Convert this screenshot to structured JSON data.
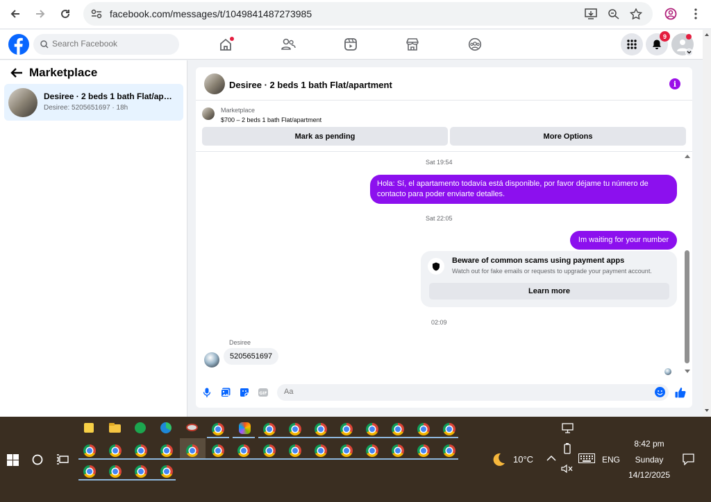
{
  "browser": {
    "url": "facebook.com/messages/t/1049841487273985"
  },
  "header": {
    "search_placeholder": "Search Facebook",
    "notification_count": "9"
  },
  "sidebar": {
    "title": "Marketplace",
    "conversation": {
      "name": "Desiree · 2 beds 1 bath Flat/apartment",
      "subtitle": "Desiree: 5205651697 · 18h"
    }
  },
  "chat": {
    "title": "Desiree · 2 beds 1 bath Flat/apartment",
    "listing_category": "Marketplace",
    "listing_price": "$700 – 2 beds 1 bath Flat/apartment",
    "mark_pending_label": "Mark as pending",
    "more_options_label": "More Options",
    "messages": [
      {
        "timestamp": "Sat 19:54",
        "text": "Hola: Sí, el apartamento todavía está disponible, por favor déjame tu número de contacto para poder enviarte detalles."
      },
      {
        "timestamp": "Sat 22:05",
        "text": "Im waiting for your number"
      }
    ],
    "scam_notice": {
      "title": "Beware of common scams using payment apps",
      "text": "Watch out for fake emails or requests to upgrade your payment account.",
      "button": "Learn more"
    },
    "incoming": {
      "timestamp": "02:09",
      "sender": "Desiree",
      "text": "5205651697"
    },
    "composer_placeholder": "Aa"
  },
  "taskbar": {
    "weather": "10°C",
    "language": "ENG",
    "time": "8:42 pm",
    "day": "Sunday",
    "date": "14/12/2025"
  },
  "colors": {
    "messenger_purple": "#8c10ee",
    "facebook_blue": "#0866ff"
  }
}
